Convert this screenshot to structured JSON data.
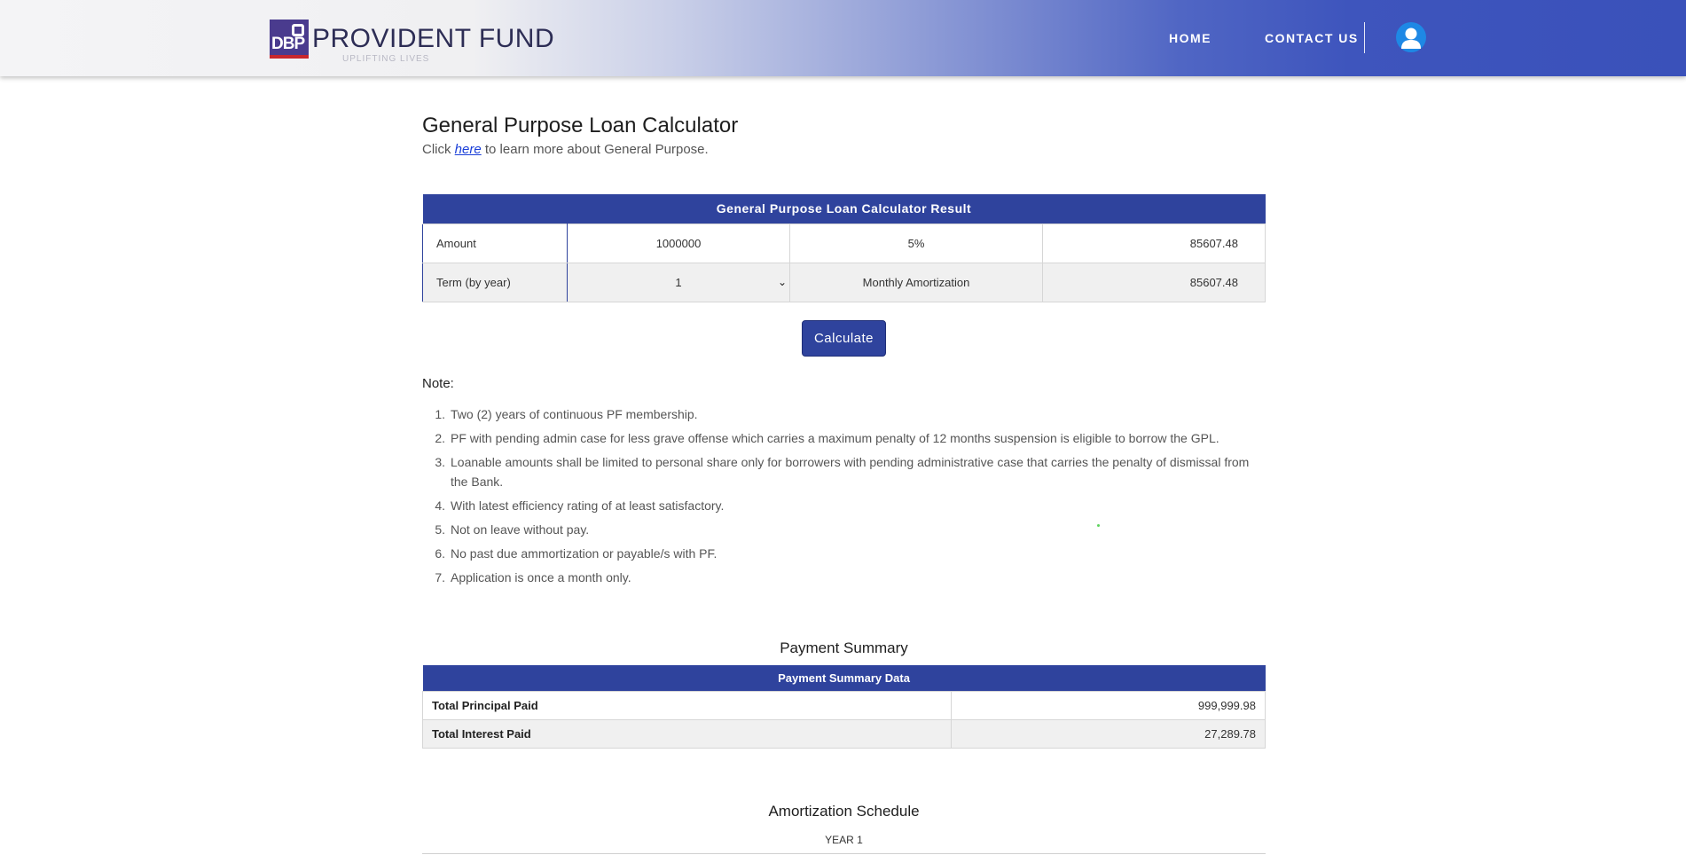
{
  "header": {
    "logo_badge": "DBP",
    "logo_name": "PROVIDENT FUND",
    "logo_tagline": "UPLIFTING LIVES",
    "nav": {
      "home": "HOME",
      "contact": "CONTACT US"
    },
    "avatar_icon": "user-icon",
    "colors": {
      "nav_bg": "#3a51ba",
      "accent": "#2f439d"
    }
  },
  "page": {
    "title": "General Purpose Loan Calculator",
    "intro_before": "Click ",
    "intro_link": "here",
    "intro_after": " to learn more about General Purpose."
  },
  "calculator": {
    "header": "General Purpose Loan Calculator Result",
    "amount_label": "Amount",
    "amount_value": "1000000",
    "rate": "5%",
    "result_top": "85607.48",
    "term_label": "Term (by year)",
    "term_value": "1",
    "monthly_label": "Monthly Amortization",
    "monthly_value": "85607.48",
    "button": "Calculate"
  },
  "notes": {
    "title": "Note:",
    "items": [
      {
        "num": "1.",
        "text": "Two (2) years of continuous PF membership."
      },
      {
        "num": "2.",
        "text": "PF with pending admin case for less grave offense which carries a maximum penalty of 12 months suspension is eligible to borrow the GPL."
      },
      {
        "num": "3.",
        "text": "Loanable amounts shall be limited to personal share only for borrowers with pending administrative case that carries the penalty of dismissal from the Bank."
      },
      {
        "num": "4.",
        "text": "With latest efficiency rating of at least satisfactory."
      },
      {
        "num": "5.",
        "text": "Not on leave without pay."
      },
      {
        "num": "6.",
        "text": "No past due ammortization or payable/s with PF."
      },
      {
        "num": "7.",
        "text": "Application is once a month only."
      }
    ]
  },
  "payment_summary": {
    "title": "Payment Summary",
    "header": "Payment Summary Data",
    "rows": [
      {
        "label": "Total Principal Paid",
        "value": "999,999.98"
      },
      {
        "label": "Total Interest Paid",
        "value": "27,289.78"
      }
    ]
  },
  "amortization": {
    "title": "Amortization Schedule",
    "year": "YEAR 1"
  }
}
